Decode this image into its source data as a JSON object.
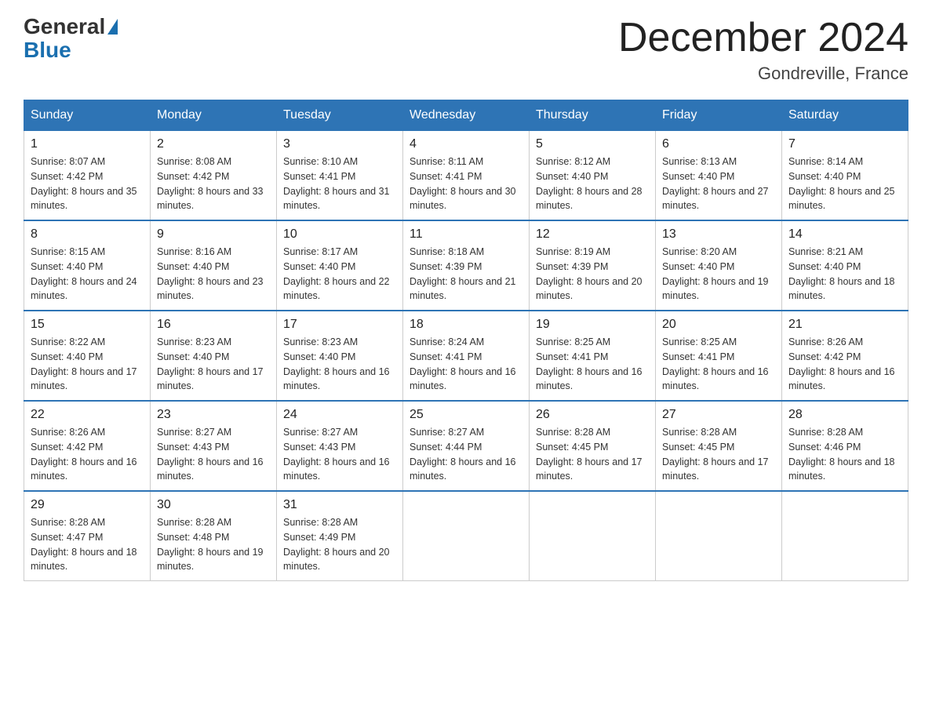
{
  "header": {
    "logo_general": "General",
    "logo_blue": "Blue",
    "title": "December 2024",
    "subtitle": "Gondreville, France"
  },
  "days_of_week": [
    "Sunday",
    "Monday",
    "Tuesday",
    "Wednesday",
    "Thursday",
    "Friday",
    "Saturday"
  ],
  "weeks": [
    [
      {
        "day": "1",
        "sunrise": "8:07 AM",
        "sunset": "4:42 PM",
        "daylight": "8 hours and 35 minutes."
      },
      {
        "day": "2",
        "sunrise": "8:08 AM",
        "sunset": "4:42 PM",
        "daylight": "8 hours and 33 minutes."
      },
      {
        "day": "3",
        "sunrise": "8:10 AM",
        "sunset": "4:41 PM",
        "daylight": "8 hours and 31 minutes."
      },
      {
        "day": "4",
        "sunrise": "8:11 AM",
        "sunset": "4:41 PM",
        "daylight": "8 hours and 30 minutes."
      },
      {
        "day": "5",
        "sunrise": "8:12 AM",
        "sunset": "4:40 PM",
        "daylight": "8 hours and 28 minutes."
      },
      {
        "day": "6",
        "sunrise": "8:13 AM",
        "sunset": "4:40 PM",
        "daylight": "8 hours and 27 minutes."
      },
      {
        "day": "7",
        "sunrise": "8:14 AM",
        "sunset": "4:40 PM",
        "daylight": "8 hours and 25 minutes."
      }
    ],
    [
      {
        "day": "8",
        "sunrise": "8:15 AM",
        "sunset": "4:40 PM",
        "daylight": "8 hours and 24 minutes."
      },
      {
        "day": "9",
        "sunrise": "8:16 AM",
        "sunset": "4:40 PM",
        "daylight": "8 hours and 23 minutes."
      },
      {
        "day": "10",
        "sunrise": "8:17 AM",
        "sunset": "4:40 PM",
        "daylight": "8 hours and 22 minutes."
      },
      {
        "day": "11",
        "sunrise": "8:18 AM",
        "sunset": "4:39 PM",
        "daylight": "8 hours and 21 minutes."
      },
      {
        "day": "12",
        "sunrise": "8:19 AM",
        "sunset": "4:39 PM",
        "daylight": "8 hours and 20 minutes."
      },
      {
        "day": "13",
        "sunrise": "8:20 AM",
        "sunset": "4:40 PM",
        "daylight": "8 hours and 19 minutes."
      },
      {
        "day": "14",
        "sunrise": "8:21 AM",
        "sunset": "4:40 PM",
        "daylight": "8 hours and 18 minutes."
      }
    ],
    [
      {
        "day": "15",
        "sunrise": "8:22 AM",
        "sunset": "4:40 PM",
        "daylight": "8 hours and 17 minutes."
      },
      {
        "day": "16",
        "sunrise": "8:23 AM",
        "sunset": "4:40 PM",
        "daylight": "8 hours and 17 minutes."
      },
      {
        "day": "17",
        "sunrise": "8:23 AM",
        "sunset": "4:40 PM",
        "daylight": "8 hours and 16 minutes."
      },
      {
        "day": "18",
        "sunrise": "8:24 AM",
        "sunset": "4:41 PM",
        "daylight": "8 hours and 16 minutes."
      },
      {
        "day": "19",
        "sunrise": "8:25 AM",
        "sunset": "4:41 PM",
        "daylight": "8 hours and 16 minutes."
      },
      {
        "day": "20",
        "sunrise": "8:25 AM",
        "sunset": "4:41 PM",
        "daylight": "8 hours and 16 minutes."
      },
      {
        "day": "21",
        "sunrise": "8:26 AM",
        "sunset": "4:42 PM",
        "daylight": "8 hours and 16 minutes."
      }
    ],
    [
      {
        "day": "22",
        "sunrise": "8:26 AM",
        "sunset": "4:42 PM",
        "daylight": "8 hours and 16 minutes."
      },
      {
        "day": "23",
        "sunrise": "8:27 AM",
        "sunset": "4:43 PM",
        "daylight": "8 hours and 16 minutes."
      },
      {
        "day": "24",
        "sunrise": "8:27 AM",
        "sunset": "4:43 PM",
        "daylight": "8 hours and 16 minutes."
      },
      {
        "day": "25",
        "sunrise": "8:27 AM",
        "sunset": "4:44 PM",
        "daylight": "8 hours and 16 minutes."
      },
      {
        "day": "26",
        "sunrise": "8:28 AM",
        "sunset": "4:45 PM",
        "daylight": "8 hours and 17 minutes."
      },
      {
        "day": "27",
        "sunrise": "8:28 AM",
        "sunset": "4:45 PM",
        "daylight": "8 hours and 17 minutes."
      },
      {
        "day": "28",
        "sunrise": "8:28 AM",
        "sunset": "4:46 PM",
        "daylight": "8 hours and 18 minutes."
      }
    ],
    [
      {
        "day": "29",
        "sunrise": "8:28 AM",
        "sunset": "4:47 PM",
        "daylight": "8 hours and 18 minutes."
      },
      {
        "day": "30",
        "sunrise": "8:28 AM",
        "sunset": "4:48 PM",
        "daylight": "8 hours and 19 minutes."
      },
      {
        "day": "31",
        "sunrise": "8:28 AM",
        "sunset": "4:49 PM",
        "daylight": "8 hours and 20 minutes."
      },
      null,
      null,
      null,
      null
    ]
  ]
}
